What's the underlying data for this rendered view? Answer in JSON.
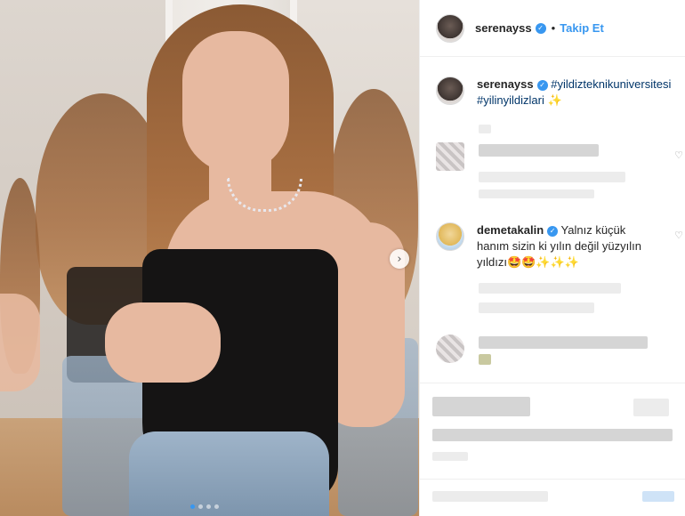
{
  "post": {
    "author": "serenayss",
    "follow_label": "Takip Et",
    "separator": "•",
    "carousel": {
      "slides": 4,
      "active_index": 0
    },
    "next_icon": "chevron-right-icon"
  },
  "caption": {
    "author": "serenayss",
    "hashtag_1": "#yildizteknikuniversitesi",
    "hashtag_2": "#yilinyildizlari",
    "emoji": "✨"
  },
  "comments": [
    {
      "author": "demetakalin",
      "text_line1": "Yalnız küçük",
      "text_line2": "hanım sizin ki yılın değil yüzyılın",
      "text_line3": "yıldızı",
      "emoji": "🤩🤩✨✨✨"
    }
  ],
  "colors": {
    "accent": "#3897f0",
    "hashtag": "#003569",
    "border": "#efefef"
  }
}
